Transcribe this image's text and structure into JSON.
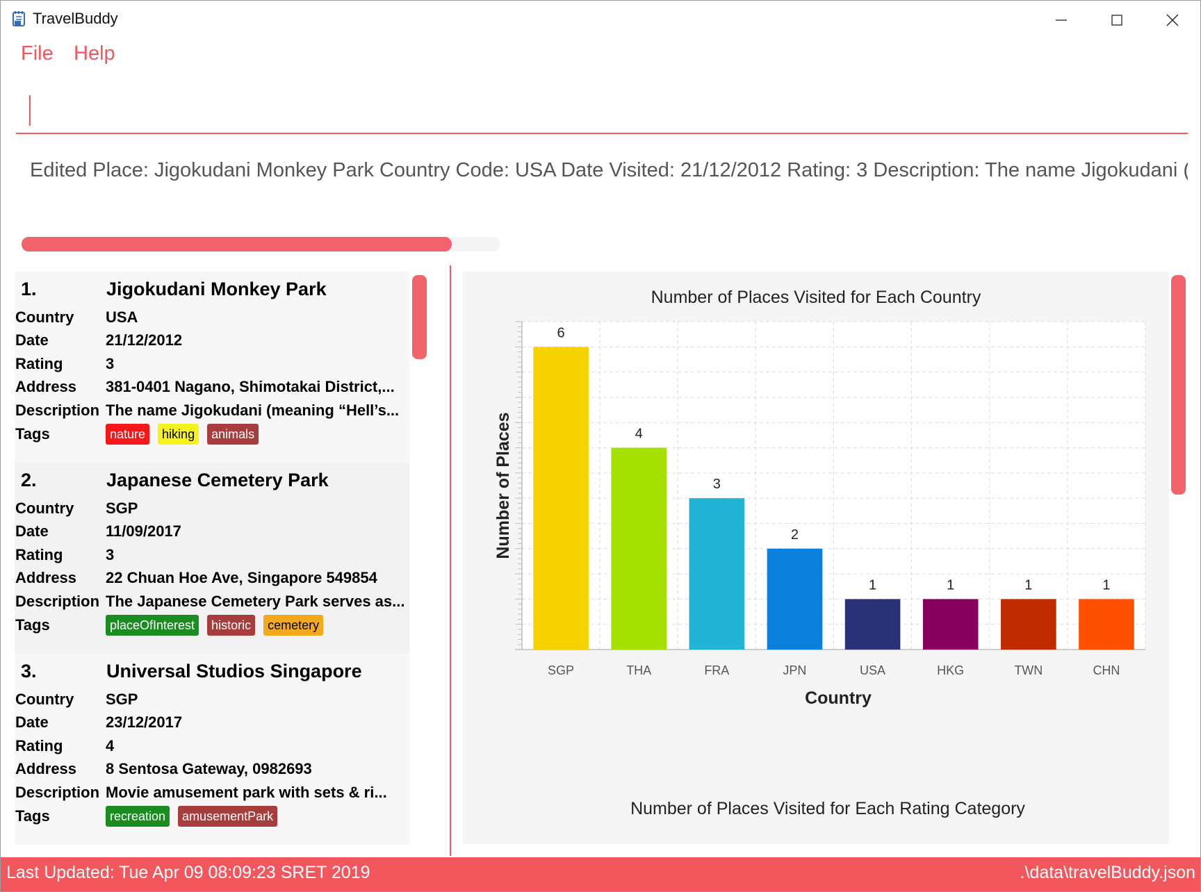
{
  "window": {
    "title": "TravelBuddy"
  },
  "menu": {
    "file": "File",
    "help": "Help"
  },
  "command": {
    "value": ""
  },
  "result": "Edited Place: Jigokudani Monkey Park Country Code: USA Date Visited: 21/12/2012 Rating: 3 Description: The name Jigokudani (mea",
  "progress": {
    "fraction": 0.9
  },
  "places": [
    {
      "index": "1.",
      "name": "Jigokudani Monkey Park",
      "labels": {
        "country": "Country",
        "date": "Date",
        "rating": "Rating",
        "address": "Address",
        "description": "Description",
        "tags": "Tags"
      },
      "country": "USA",
      "date": "21/12/2012",
      "rating": "3",
      "address": "381-0401 Nagano, Shimotakai District,...",
      "description": "The name Jigokudani (meaning “Hell’s...",
      "tags": [
        {
          "name": "nature",
          "bg": "#f5171a",
          "fg": "#ffffff"
        },
        {
          "name": "hiking",
          "bg": "#f6f31c",
          "fg": "#000000"
        },
        {
          "name": "animals",
          "bg": "#a83d3d",
          "fg": "#ffffff"
        }
      ]
    },
    {
      "index": "2.",
      "name": "Japanese Cemetery Park",
      "labels": {
        "country": "Country",
        "date": "Date",
        "rating": "Rating",
        "address": "Address",
        "description": "Description",
        "tags": "Tags"
      },
      "country": "SGP",
      "date": "11/09/2017",
      "rating": "3",
      "address": "22 Chuan Hoe Ave, Singapore 549854",
      "description": "The Japanese Cemetery Park serves as...",
      "tags": [
        {
          "name": "placeOfInterest",
          "bg": "#1a8c20",
          "fg": "#ffffff"
        },
        {
          "name": "historic",
          "bg": "#a83d3d",
          "fg": "#ffffff"
        },
        {
          "name": "cemetery",
          "bg": "#f4a91c",
          "fg": "#000000"
        }
      ]
    },
    {
      "index": "3.",
      "name": "Universal Studios Singapore",
      "labels": {
        "country": "Country",
        "date": "Date",
        "rating": "Rating",
        "address": "Address",
        "description": "Description",
        "tags": "Tags"
      },
      "country": "SGP",
      "date": "23/12/2017",
      "rating": "4",
      "address": "8 Sentosa Gateway, 0982693",
      "description": "Movie amusement park with sets & ri...",
      "tags": [
        {
          "name": "recreation",
          "bg": "#1a8c20",
          "fg": "#ffffff"
        },
        {
          "name": "amusementPark",
          "bg": "#a83d3d",
          "fg": "#ffffff"
        }
      ]
    }
  ],
  "chart_data": [
    {
      "type": "bar",
      "title": "Number of Places Visited for Each Country",
      "xlabel": "Country",
      "ylabel": "Number of Places",
      "categories": [
        "SGP",
        "THA",
        "FRA",
        "JPN",
        "USA",
        "HKG",
        "TWN",
        "CHN"
      ],
      "values": [
        6,
        4,
        3,
        2,
        1,
        1,
        1,
        1
      ],
      "colors": [
        "#f5d200",
        "#a6e000",
        "#22b4d4",
        "#0a80dc",
        "#2b3177",
        "#87005c",
        "#c02b00",
        "#ff5000"
      ],
      "ylim": [
        0,
        6.5
      ],
      "grid": true,
      "data_labels": true
    },
    {
      "type": "bar",
      "title": "Number of Places Visited for Each Rating Category"
    }
  ],
  "status": {
    "last_updated": "Last Updated: Tue Apr 09 08:09:23 SRET 2019",
    "file_path": ".\\data\\travelBuddy.json"
  },
  "colors": {
    "accent": "#f2575e",
    "panel_bg": "#f5f5f5"
  },
  "icons": {
    "app": "notebook-icon",
    "minimize": "minimize-icon",
    "maximize": "maximize-icon",
    "close": "close-icon"
  }
}
